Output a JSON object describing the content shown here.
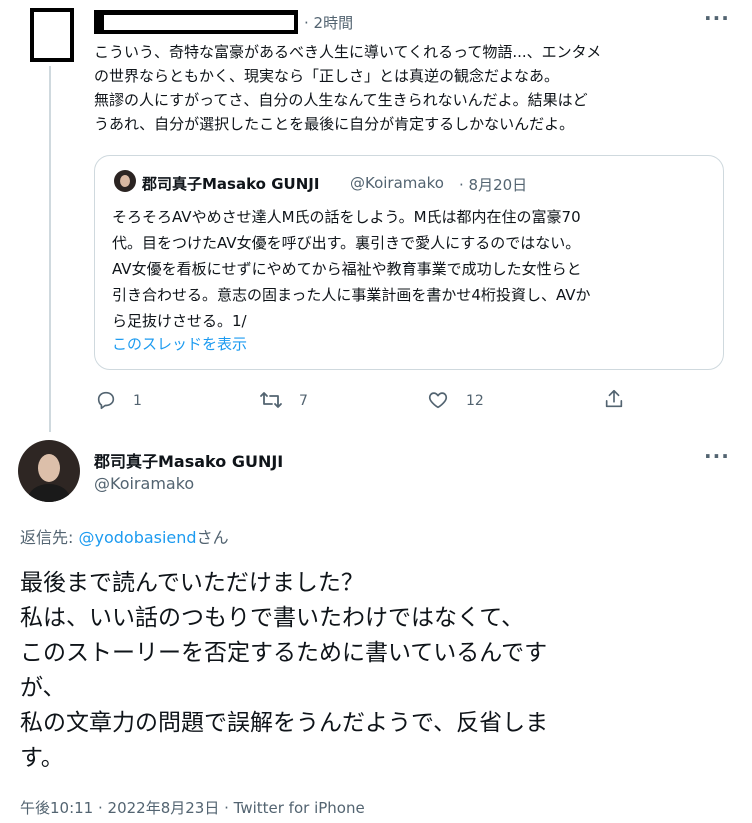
{
  "reply_tweet": {
    "time": "· 2時間",
    "lines": [
      "こういう、奇特な富豪があるべき人生に導いてくれるって物語...、エンタメ",
      "の世界ならともかく、現実なら「正しさ」とは真逆の観念だよなあ。",
      "無謬の人にすがってさ、自分の人生なんて生きられないんだよ。結果はど",
      "うあれ、自分が選択したことを最後に自分が肯定するしかないんだよ。"
    ],
    "more_icon": "more-horizontal-icon"
  },
  "quoted_tweet": {
    "name": "郡司真子Masako GUNJI",
    "handle": "@Koiramako",
    "date": "· 8月20日",
    "lines": [
      "そろそろAVやめさせ達人M氏の話をしよう。M氏は都内在住の富豪70",
      "代。目をつけたAV女優を呼び出す。裏引きで愛人にするのではない。",
      "AV女優を看板にせずにやめてから福祉や教育事業で成功した女性らと",
      "引き合わせる。意志の固まった人に事業計画を書かせ4桁投資し、AVか",
      "ら足抜けさせる。1/"
    ],
    "show_thread": "このスレッドを表示"
  },
  "actions": {
    "reply_count": "1",
    "retweet_count": "7",
    "like_count": "12"
  },
  "main_tweet": {
    "name": "郡司真子Masako GUNJI",
    "handle": "@Koiramako",
    "reply_to_prefix": "返信先: ",
    "reply_to_handle": "@yodobasiend",
    "reply_to_suffix": "さん",
    "lines": [
      "最後まで読んでいただけました？",
      "私は、いい話のつもりで書いたわけではなくて、",
      "このストーリーを否定するために書いているんです",
      "が、",
      "私の文章力の問題で誤解をうんだようで、反省しま",
      "す。"
    ],
    "timestamp": "午後10:11 · 2022年8月23日 · Twitter for iPhone"
  },
  "colors": {
    "accent": "#1d9bf0",
    "secondary_text": "#536471",
    "border": "#cfd9de"
  }
}
